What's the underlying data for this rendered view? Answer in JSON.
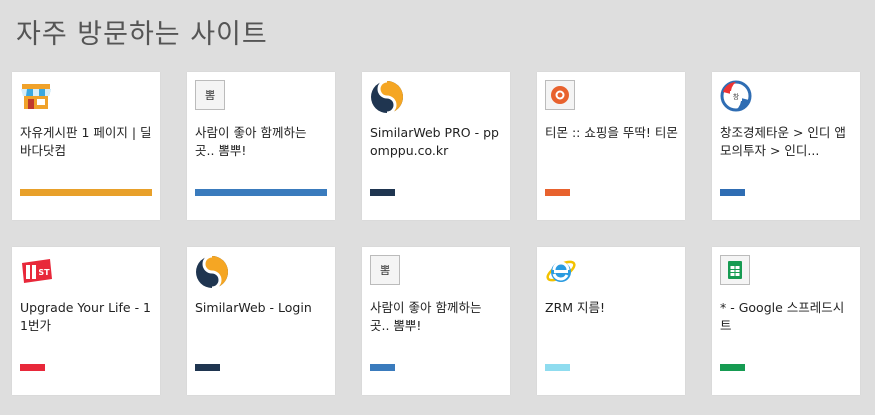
{
  "page": {
    "title": "자주 방문하는 사이트"
  },
  "tiles": [
    {
      "label": "자유게시판 1 페이지 | 딜바다닷컴",
      "icon": "store-icon",
      "color": "#e8a02a",
      "bar": "full"
    },
    {
      "label": "사람이 좋아 함께하는 곳.. 뽐뿌!",
      "icon": "ppomppu-icon",
      "icon_text": "뽐",
      "color": "#3a7bbd",
      "bar": "full"
    },
    {
      "label": "SimilarWeb PRO - ppomppu.co.kr",
      "icon": "similarweb-icon",
      "color": "#1f3550",
      "bar": "short"
    },
    {
      "label": "티몬 :: 쇼핑을 뚜딱! 티몬",
      "icon": "tmon-icon",
      "color": "#e8622e",
      "bar": "short"
    },
    {
      "label": "창조경제타운 > 인디 앱 모의투자 > 인디...",
      "icon": "creative-economy-icon",
      "color": "#2f6db3",
      "bar": "short"
    },
    {
      "label": "Upgrade Your Life - 11번가",
      "icon": "11st-icon",
      "color": "#e8283a",
      "bar": "short"
    },
    {
      "label": "SimilarWeb - Login",
      "icon": "similarweb-icon",
      "color": "#1f3550",
      "bar": "short"
    },
    {
      "label": "사람이 좋아 함께하는 곳.. 뽐뿌!",
      "icon": "ppomppu-icon",
      "icon_text": "뽐",
      "color": "#3a7bbd",
      "bar": "short"
    },
    {
      "label": "ZRM 지름!",
      "icon": "internet-explorer-icon",
      "color": "#8fdcef",
      "bar": "short"
    },
    {
      "label": "* - Google 스프레드시트",
      "icon": "google-sheets-icon",
      "color": "#169b52",
      "bar": "short"
    }
  ]
}
